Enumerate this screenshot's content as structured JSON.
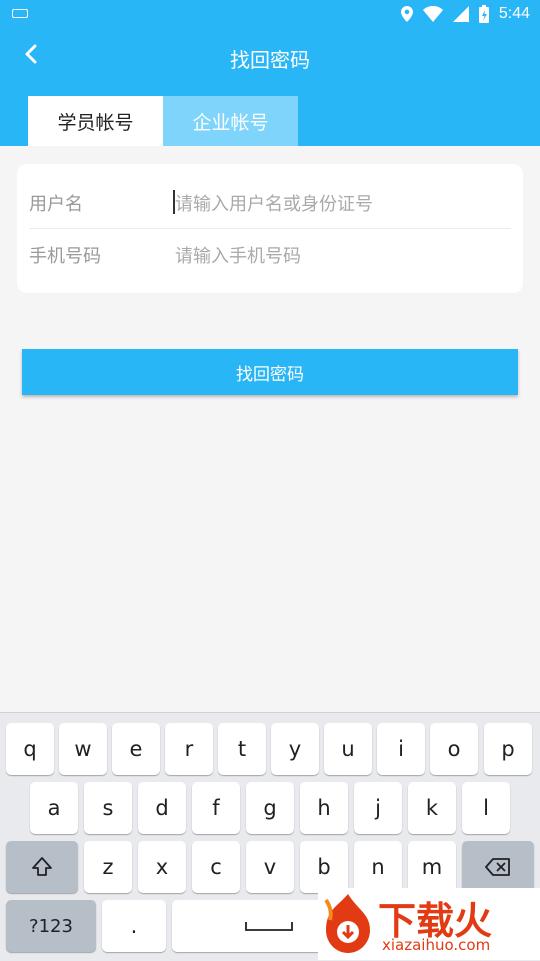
{
  "status_bar": {
    "time": "5:44"
  },
  "header": {
    "title": "找回密码",
    "tabs": [
      {
        "label": "学员帐号",
        "active": true
      },
      {
        "label": "企业帐号",
        "active": false
      }
    ]
  },
  "form": {
    "username": {
      "label": "用户名",
      "placeholder": "请输入用户名或身份证号"
    },
    "phone": {
      "label": "手机号码",
      "placeholder": "请输入手机号码"
    }
  },
  "submit_label": "找回密码",
  "keyboard": {
    "row1": [
      "q",
      "w",
      "e",
      "r",
      "t",
      "y",
      "u",
      "i",
      "o",
      "p"
    ],
    "row2": [
      "a",
      "s",
      "d",
      "f",
      "g",
      "h",
      "j",
      "k",
      "l"
    ],
    "row3": [
      "z",
      "x",
      "c",
      "v",
      "b",
      "n",
      "m"
    ],
    "symbols_label": "?123",
    "period_label": "."
  },
  "watermark": {
    "brand": "下载火",
    "url": "xiazaihuo.com"
  },
  "colors": {
    "accent": "#29b6f6",
    "tab_inactive": "#7fd4fb",
    "watermark": "#e23b13"
  }
}
